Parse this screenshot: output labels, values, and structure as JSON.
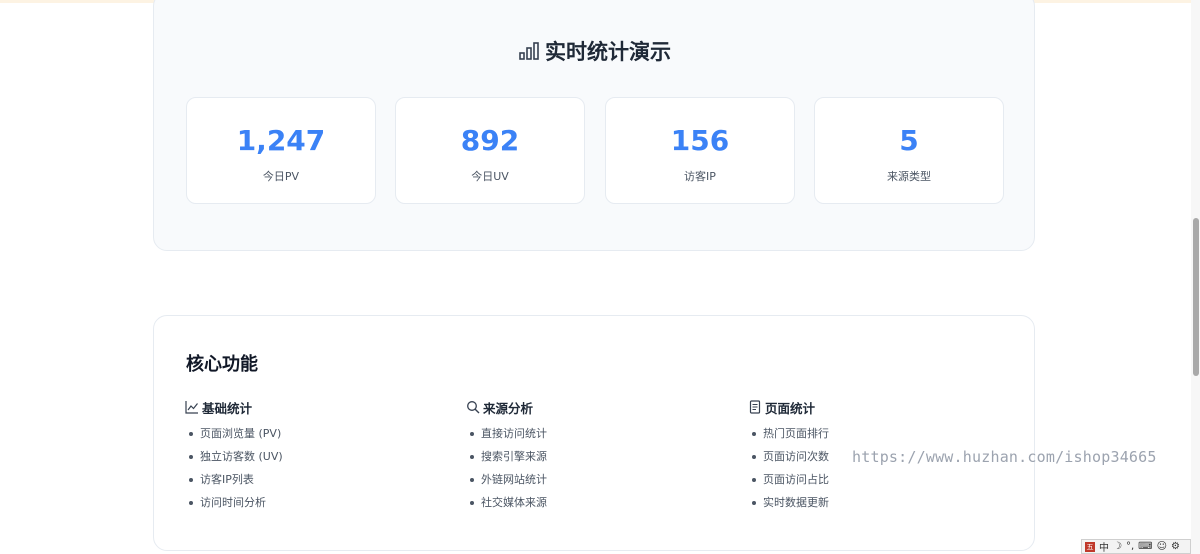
{
  "realtime": {
    "title": "实时统计演示",
    "title_icon": "bar-chart-icon",
    "stats": [
      {
        "value": "1,247",
        "label": "今日PV"
      },
      {
        "value": "892",
        "label": "今日UV"
      },
      {
        "value": "156",
        "label": "访客IP"
      },
      {
        "value": "5",
        "label": "来源类型"
      }
    ]
  },
  "features": {
    "title": "核心功能",
    "columns": [
      {
        "icon": "line-chart-icon",
        "heading": "基础统计",
        "items": [
          "页面浏览量 (PV)",
          "独立访客数 (UV)",
          "访客IP列表",
          "访问时间分析"
        ]
      },
      {
        "icon": "search-icon",
        "heading": "来源分析",
        "items": [
          "直接访问统计",
          "搜索引擎来源",
          "外链网站统计",
          "社交媒体来源"
        ]
      },
      {
        "icon": "document-icon",
        "heading": "页面统计",
        "items": [
          "热门页面排行",
          "页面访问次数",
          "页面访问占比",
          "实时数据更新"
        ]
      }
    ]
  },
  "watermark": "https://www.huzhan.com/ishop34665",
  "ime": {
    "mode": "中",
    "logo": "五"
  },
  "colors": {
    "accent": "#3b82f6",
    "card_border": "#e6ebf1",
    "section_bg": "#f8fafc"
  }
}
